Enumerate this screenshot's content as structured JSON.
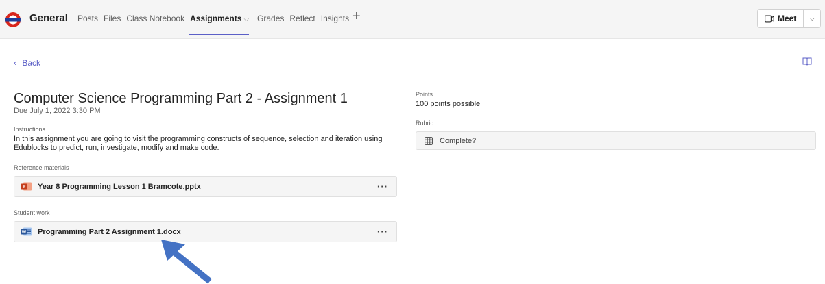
{
  "header": {
    "team_name": "General",
    "tabs": [
      {
        "label": "Posts"
      },
      {
        "label": "Files"
      },
      {
        "label": "Class Notebook"
      },
      {
        "label": "Assignments",
        "active": true
      },
      {
        "label": "Grades"
      },
      {
        "label": "Reflect"
      },
      {
        "label": "Insights"
      }
    ],
    "meet_label": "Meet"
  },
  "nav": {
    "back_label": "Back"
  },
  "assignment": {
    "title": "Computer Science Programming Part 2 - Assignment 1",
    "due": "Due July 1, 2022 3:30 PM",
    "instructions_label": "Instructions",
    "instructions_text": "In this assignment you are going to visit the programming constructs of sequence, selection and iteration using Edublocks to predict, run, investigate, modify and make code.",
    "reference_label": "Reference materials",
    "reference_file": {
      "name": "Year 8 Programming Lesson 1 Bramcote.pptx",
      "icon": "powerpoint-icon"
    },
    "student_work_label": "Student work",
    "student_file": {
      "name": "Programming Part 2 Assignment 1.docx",
      "icon": "word-icon"
    },
    "more_label": "···"
  },
  "side": {
    "points_label": "Points",
    "points_value": "100 points possible",
    "rubric_label": "Rubric",
    "rubric_item": "Complete?"
  },
  "colors": {
    "accent": "#5b5fc7",
    "arrow": "#4472c4",
    "logo_red": "#d9261c",
    "logo_blue": "#1f3d99"
  }
}
